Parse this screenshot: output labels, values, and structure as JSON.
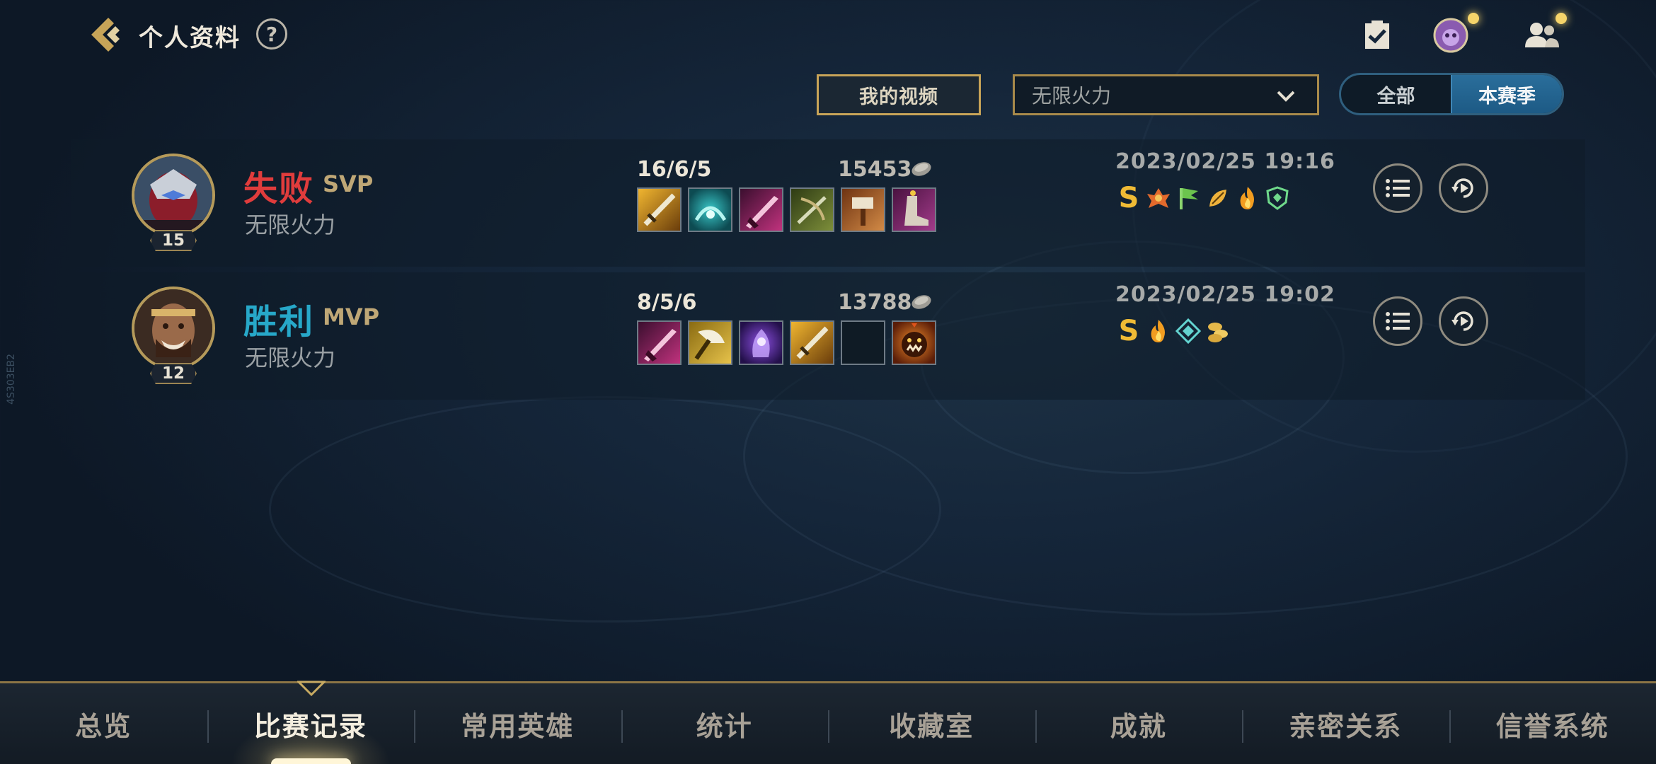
{
  "header": {
    "title": "个人资料",
    "help_label": "?"
  },
  "filters": {
    "video_button": "我的视频",
    "mode_select": "无限火力",
    "season_toggle": {
      "all": "全部",
      "season": "本赛季",
      "selected": "本赛季"
    }
  },
  "matches": [
    {
      "result": "失败",
      "honor": "SVP",
      "mode": "无限火力",
      "level": "15",
      "kda": "16/6/5",
      "gold": "15453",
      "date": "2023/02/25 19:16",
      "grade": "S",
      "items": [
        "sword-lightning-item",
        "teal-rune-item",
        "pink-blade-item",
        "green-crossbow-item",
        "hammer-item",
        "boots-item"
      ],
      "badges": [
        "crest-badge",
        "flag-badge",
        "leaf-badge",
        "flame-badge",
        "shield-badge"
      ]
    },
    {
      "result": "胜利",
      "honor": "MVP",
      "mode": "无限火力",
      "level": "12",
      "kda": "8/5/6",
      "gold": "13788",
      "date": "2023/02/25 19:02",
      "grade": "S",
      "items": [
        "pink-blade-item",
        "gold-axe-item",
        "purple-spirit-item",
        "sword-lightning-item",
        "empty-item",
        "demon-mask-item"
      ],
      "badges": [
        "flame-badge",
        "diamond-shield-badge",
        "coins-badge"
      ]
    }
  ],
  "bottom_nav": {
    "tabs": [
      "总览",
      "比赛记录",
      "常用英雄",
      "统计",
      "收藏室",
      "成就",
      "亲密关系",
      "信誉系统"
    ],
    "active": "比赛记录"
  },
  "side_text": "4S303EB2",
  "colors": {
    "loss": "#e03c3c",
    "win": "#27a8c9",
    "gold_accent": "#c8a458",
    "active_toggle": "#2a6e9b"
  }
}
